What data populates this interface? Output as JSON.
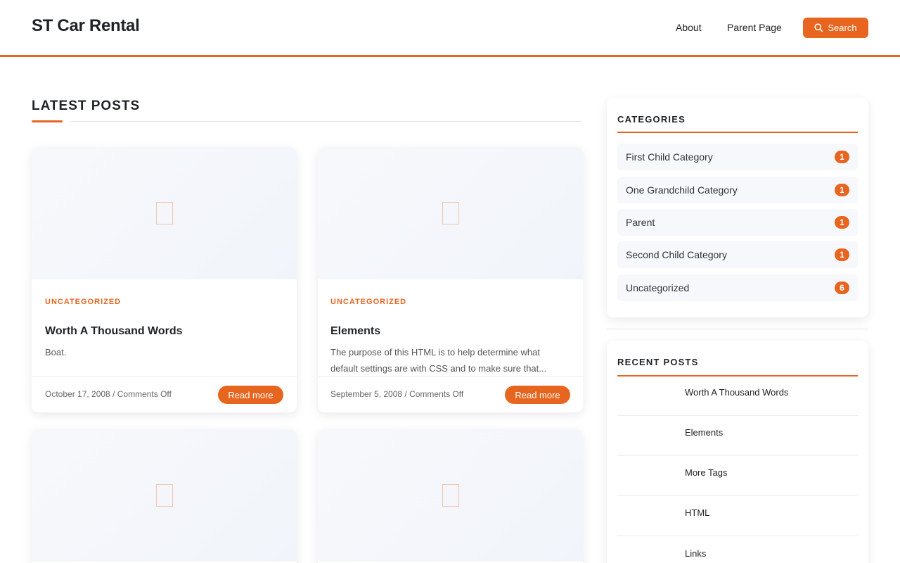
{
  "header": {
    "site_title": "ST Car Rental",
    "nav": [
      "About",
      "Parent Page"
    ],
    "search_label": "Search",
    "accent": "#e8651f"
  },
  "main": {
    "section_title": "LATEST POSTS",
    "posts": [
      {
        "category": "UNCATEGORIZED",
        "title": "Worth A Thousand Words",
        "excerpt": "Boat.",
        "meta": "October 17, 2008 / Comments Off",
        "read_more": "Read more",
        "image_icon": "image-placeholder-icon"
      },
      {
        "category": "UNCATEGORIZED",
        "title": "Elements",
        "excerpt": "The purpose of this HTML is to help determine what default settings are with CSS and to make sure that...",
        "meta": "September 5, 2008 / Comments Off",
        "read_more": "Read more",
        "image_icon": "image-placeholder-icon"
      },
      {
        "image_icon": "image-placeholder-icon"
      },
      {
        "image_icon": "image-placeholder-icon"
      }
    ]
  },
  "sidebar": {
    "categories": {
      "title": "CATEGORIES",
      "items": [
        {
          "label": "First Child Category",
          "count": "1"
        },
        {
          "label": "One Grandchild Category",
          "count": "1"
        },
        {
          "label": "Parent",
          "count": "1"
        },
        {
          "label": "Second Child Category",
          "count": "1"
        },
        {
          "label": "Uncategorized",
          "count": "6"
        }
      ]
    },
    "recent_posts": {
      "title": "RECENT POSTS",
      "items": [
        "Worth A Thousand Words",
        "Elements",
        "More Tags",
        "HTML",
        "Links"
      ]
    }
  }
}
